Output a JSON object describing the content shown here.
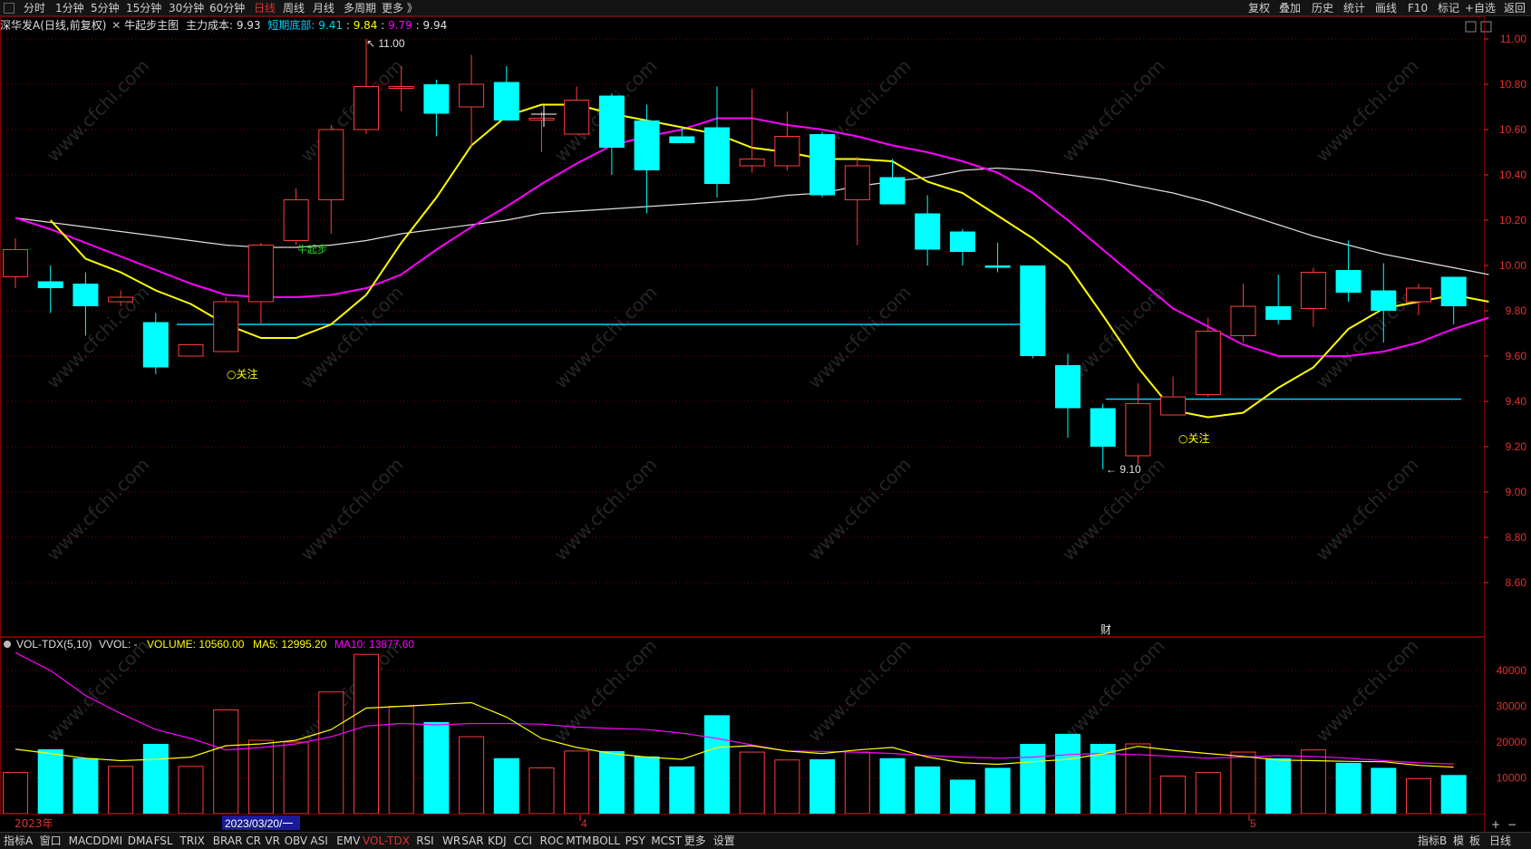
{
  "colors": {
    "up": "#ff3b3b",
    "down": "#00ffff",
    "ma5": "#ffff00",
    "ma10": "#ff00ff",
    "ma60": "#dddddd",
    "support": "#00d0ff",
    "grid": "#7a0000",
    "axis_text": "#e03030",
    "tag": "#ffff00"
  },
  "top_tabs": [
    "分时",
    "1分钟",
    "5分钟",
    "15分钟",
    "30分钟",
    "60分钟",
    "日线",
    "周线",
    "月线",
    "多周期",
    "更多 》"
  ],
  "active_tab": "日线",
  "top_right_buttons": [
    "复权",
    "叠加",
    "历史",
    "统计",
    "画线",
    "F10",
    "标记",
    "+自选",
    "返回"
  ],
  "header": {
    "stock": "深华发A",
    "period": "(日线,前复权)",
    "indicator_name": "牛起步主图",
    "cost_label": "主力成本:",
    "cost_value": "9.93",
    "bottom_label": "短期底部:",
    "bottom_value": "9.41",
    "v1": "9.84",
    "v2": "9.79",
    "v3": "9.94",
    "sep": ":"
  },
  "volume_header": {
    "name": "VOL-TDX(5,10)",
    "vvol": "VVOL: -",
    "volume": "VOLUME: 10560.00",
    "ma5": "MA5: 12995.20",
    "ma10": "MA10: 13877.60"
  },
  "price_axis": [
    "11.00",
    "10.80",
    "10.60",
    "10.40",
    "10.20",
    "10.00",
    "9.80",
    "9.60",
    "9.40",
    "9.20",
    "9.00",
    "8.80",
    "8.60"
  ],
  "volume_axis": [
    "40000",
    "30000",
    "20000",
    "10000"
  ],
  "annotations": {
    "high": "11.00",
    "low": "9.10",
    "tag1": "关注",
    "tag2": "关注",
    "niuqibu": "牛起步",
    "cai": "财"
  },
  "date_labels": {
    "year": "2023年",
    "cursor_date": "2023/03/20/一",
    "month4": "4",
    "month5": "5"
  },
  "bottom_tabs": [
    "指标A",
    "窗口",
    "MACD",
    "DMI",
    "DMA",
    "FSL",
    "TRIX",
    "BRAR",
    "CR",
    "VR",
    "OBV",
    "ASI",
    "EMV",
    "VOL-TDX",
    "RSI",
    "WR",
    "SAR",
    "KDJ",
    "CCI",
    "ROC",
    "MTM",
    "BOLL",
    "PSY",
    "MCST",
    "更多",
    "设置"
  ],
  "active_bottom_tab": "VOL-TDX",
  "bottom_right": [
    "指标B",
    "模",
    "板",
    "日线"
  ],
  "watermark": "www.cfchi.com",
  "chart_data": {
    "type": "candlestick",
    "price_range": [
      8.5,
      11.1
    ],
    "volume_range": [
      0,
      44000
    ],
    "support_line_1": 9.74,
    "support_line_2": 9.41,
    "candles": [
      {
        "o": 9.95,
        "h": 10.12,
        "l": 9.9,
        "c": 10.07
      },
      {
        "o": 9.93,
        "h": 10.0,
        "l": 9.79,
        "c": 9.9
      },
      {
        "o": 9.92,
        "h": 9.97,
        "l": 9.69,
        "c": 9.82
      },
      {
        "o": 9.84,
        "h": 9.89,
        "l": 9.82,
        "c": 9.86
      },
      {
        "o": 9.75,
        "h": 9.79,
        "l": 9.52,
        "c": 9.55
      },
      {
        "o": 9.6,
        "h": 9.65,
        "l": 9.6,
        "c": 9.65
      },
      {
        "o": 9.62,
        "h": 9.86,
        "l": 9.62,
        "c": 9.84
      },
      {
        "o": 9.84,
        "h": 10.1,
        "l": 9.74,
        "c": 10.09
      },
      {
        "o": 10.11,
        "h": 10.34,
        "l": 10.09,
        "c": 10.29
      },
      {
        "o": 10.29,
        "h": 10.62,
        "l": 10.14,
        "c": 10.6
      },
      {
        "o": 10.6,
        "h": 11.0,
        "l": 10.58,
        "c": 10.79
      },
      {
        "o": 10.79,
        "h": 10.88,
        "l": 10.68,
        "c": 10.79
      },
      {
        "o": 10.8,
        "h": 10.82,
        "l": 10.57,
        "c": 10.67
      },
      {
        "o": 10.7,
        "h": 10.93,
        "l": 10.52,
        "c": 10.8
      },
      {
        "o": 10.81,
        "h": 10.88,
        "l": 10.64,
        "c": 10.64
      },
      {
        "o": 10.65,
        "h": 10.68,
        "l": 10.5,
        "c": 10.65
      },
      {
        "o": 10.58,
        "h": 10.79,
        "l": 10.58,
        "c": 10.73
      },
      {
        "o": 10.75,
        "h": 10.76,
        "l": 10.4,
        "c": 10.52
      },
      {
        "o": 10.64,
        "h": 10.71,
        "l": 10.23,
        "c": 10.42
      },
      {
        "o": 10.57,
        "h": 10.61,
        "l": 10.54,
        "c": 10.54
      },
      {
        "o": 10.61,
        "h": 10.79,
        "l": 10.3,
        "c": 10.36
      },
      {
        "o": 10.44,
        "h": 10.78,
        "l": 10.41,
        "c": 10.47
      },
      {
        "o": 10.44,
        "h": 10.68,
        "l": 10.42,
        "c": 10.57
      },
      {
        "o": 10.58,
        "h": 10.59,
        "l": 10.3,
        "c": 10.31
      },
      {
        "o": 10.29,
        "h": 10.48,
        "l": 10.09,
        "c": 10.44
      },
      {
        "o": 10.39,
        "h": 10.47,
        "l": 10.28,
        "c": 10.27
      },
      {
        "o": 10.23,
        "h": 10.31,
        "l": 10.0,
        "c": 10.07
      },
      {
        "o": 10.15,
        "h": 10.16,
        "l": 10.0,
        "c": 10.06
      },
      {
        "o": 10.0,
        "h": 10.1,
        "l": 9.97,
        "c": 9.99
      },
      {
        "o": 10.0,
        "h": 10.0,
        "l": 9.59,
        "c": 9.6
      },
      {
        "o": 9.56,
        "h": 9.61,
        "l": 9.24,
        "c": 9.37
      },
      {
        "o": 9.37,
        "h": 9.39,
        "l": 9.1,
        "c": 9.2
      },
      {
        "o": 9.16,
        "h": 9.48,
        "l": 9.12,
        "c": 9.39
      },
      {
        "o": 9.34,
        "h": 9.51,
        "l": 9.34,
        "c": 9.42
      },
      {
        "o": 9.43,
        "h": 9.77,
        "l": 9.42,
        "c": 9.71
      },
      {
        "o": 9.69,
        "h": 9.92,
        "l": 9.66,
        "c": 9.82
      },
      {
        "o": 9.82,
        "h": 9.96,
        "l": 9.74,
        "c": 9.76
      },
      {
        "o": 9.81,
        "h": 9.99,
        "l": 9.73,
        "c": 9.97
      },
      {
        "o": 9.98,
        "h": 10.11,
        "l": 9.84,
        "c": 9.88
      },
      {
        "o": 9.89,
        "h": 10.01,
        "l": 9.66,
        "c": 9.8
      },
      {
        "o": 9.84,
        "h": 9.92,
        "l": 9.78,
        "c": 9.9
      },
      {
        "o": 9.95,
        "h": 9.95,
        "l": 9.74,
        "c": 9.82
      }
    ],
    "ma5": [
      10.2,
      10.03,
      9.97,
      9.89,
      9.83,
      9.74,
      9.68,
      9.68,
      9.74,
      9.87,
      10.1,
      10.3,
      10.53,
      10.66,
      10.71,
      10.71,
      10.67,
      10.64,
      10.61,
      10.58,
      10.52,
      10.5,
      10.47,
      10.47,
      10.46,
      10.37,
      10.32,
      10.22,
      10.12,
      10.0,
      9.78,
      9.55,
      9.36,
      9.33,
      9.35,
      9.46,
      9.55,
      9.72,
      9.81,
      9.84,
      9.87,
      9.84
    ],
    "ma10": [
      10.21,
      10.16,
      10.1,
      10.04,
      9.98,
      9.92,
      9.87,
      9.86,
      9.86,
      9.87,
      9.9,
      9.96,
      10.07,
      10.17,
      10.26,
      10.36,
      10.45,
      10.53,
      10.57,
      10.6,
      10.65,
      10.65,
      10.62,
      10.6,
      10.57,
      10.53,
      10.5,
      10.46,
      10.41,
      10.32,
      10.2,
      10.07,
      9.94,
      9.81,
      9.73,
      9.65,
      9.6,
      9.6,
      9.6,
      9.62,
      9.66,
      9.72,
      9.77
    ],
    "ma_long": [
      10.21,
      10.19,
      10.17,
      10.15,
      10.13,
      10.11,
      10.09,
      10.08,
      10.08,
      10.09,
      10.11,
      10.14,
      10.16,
      10.18,
      10.2,
      10.23,
      10.24,
      10.25,
      10.26,
      10.27,
      10.28,
      10.29,
      10.31,
      10.32,
      10.35,
      10.37,
      10.39,
      10.42,
      10.43,
      10.42,
      10.4,
      10.38,
      10.35,
      10.32,
      10.28,
      10.23,
      10.18,
      10.13,
      10.09,
      10.05,
      10.02,
      9.99,
      9.96
    ],
    "volumes": [
      11500,
      18000,
      15500,
      13200,
      19500,
      13200,
      29000,
      20500,
      20000,
      34000,
      44500,
      30000,
      25600,
      21500,
      15500,
      12800,
      17500,
      17500,
      16000,
      13200,
      27500,
      17200,
      15000,
      15200,
      17200,
      15500,
      13200,
      9500,
      12800,
      19500,
      22300,
      19500,
      19500,
      10500,
      11500,
      17200,
      15500,
      17800,
      14200,
      12800,
      9800,
      10800
    ],
    "vol_ma5": [
      18000,
      16800,
      15500,
      14800,
      15200,
      15800,
      19000,
      19500,
      20500,
      23500,
      29500,
      30000,
      30500,
      31000,
      27000,
      21000,
      18500,
      16800,
      15800,
      15200,
      18500,
      19000,
      17500,
      16800,
      17800,
      18500,
      15800,
      14200,
      13800,
      14500,
      15200,
      16700,
      18800,
      17700,
      16800,
      16000,
      15000,
      14800,
      14600,
      14500,
      13500,
      12995
    ],
    "vol_ma10": [
      45000,
      40000,
      33000,
      28000,
      23500,
      21000,
      17800,
      18500,
      19500,
      21500,
      24500,
      25200,
      24800,
      25200,
      25200,
      25000,
      24200,
      23800,
      23500,
      22500,
      21000,
      19200,
      17500,
      17400,
      17200,
      16800,
      16200,
      15800,
      15500,
      15800,
      16500,
      16800,
      16500,
      16000,
      15500,
      15800,
      16200,
      16000,
      15500,
      14800,
      14200,
      13877
    ]
  }
}
